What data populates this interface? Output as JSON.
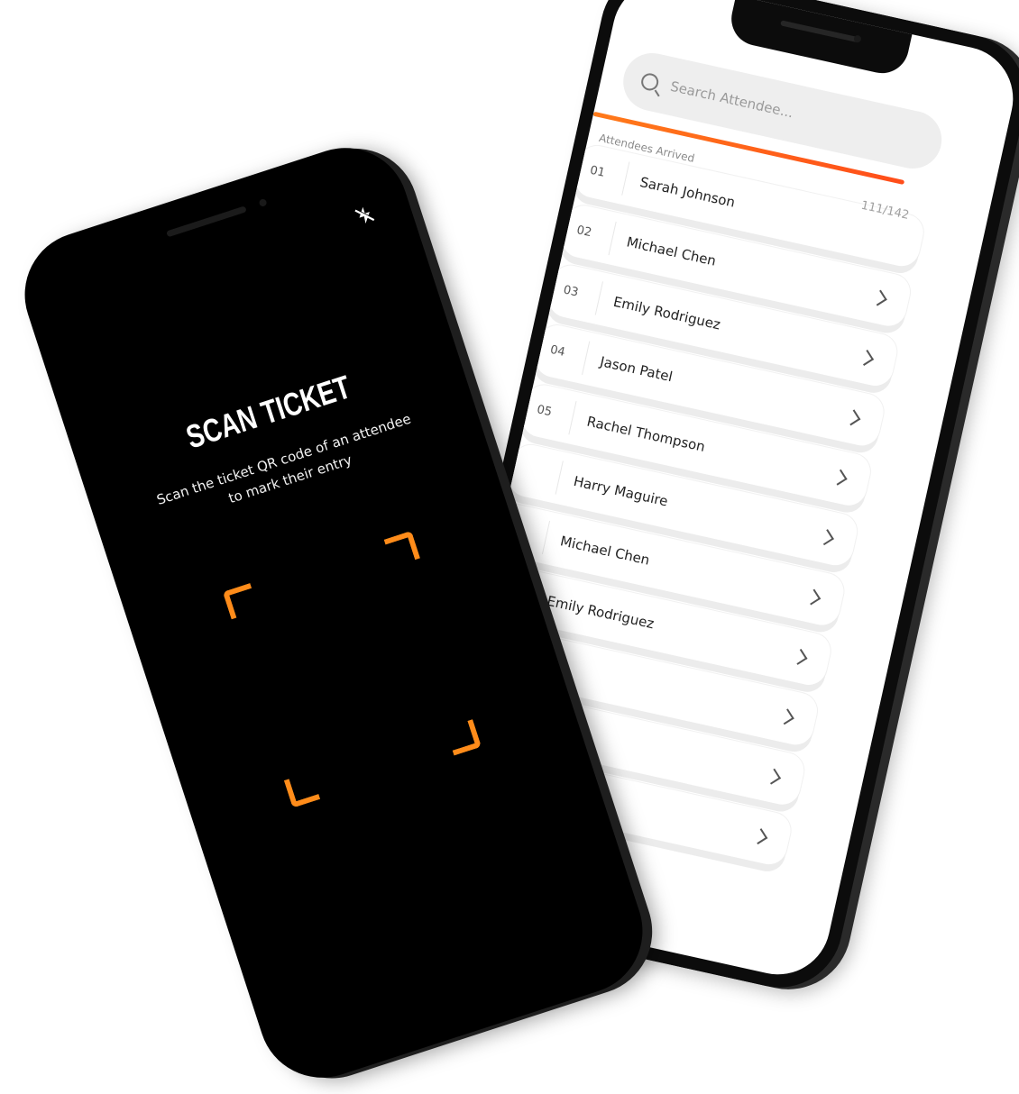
{
  "attendee_app": {
    "search": {
      "placeholder": "Search Attendee..."
    },
    "progress": {
      "label": "Attendees Arrived",
      "count": "111/142",
      "fraction": 0.78
    },
    "attendees": [
      {
        "number": "01",
        "name": "Sarah Johnson"
      },
      {
        "number": "02",
        "name": "Michael Chen"
      },
      {
        "number": "03",
        "name": "Emily Rodriguez"
      },
      {
        "number": "04",
        "name": "Jason Patel"
      },
      {
        "number": "05",
        "name": "Rachel Thompson"
      },
      {
        "number": "",
        "name": "Harry Maguire"
      },
      {
        "number": "",
        "name": "Michael Chen"
      },
      {
        "number": "",
        "name": "Emily Rodriguez"
      },
      {
        "number": "",
        "name": ""
      },
      {
        "number": "",
        "name": ""
      },
      {
        "number": "",
        "name": ""
      }
    ]
  },
  "scanner_app": {
    "title": "SCAN TICKET",
    "subtitle": "Scan the ticket QR code of an attendee to mark their entry",
    "flash_icon": "flash-off-icon",
    "accent_color": "#ff8c1a"
  }
}
